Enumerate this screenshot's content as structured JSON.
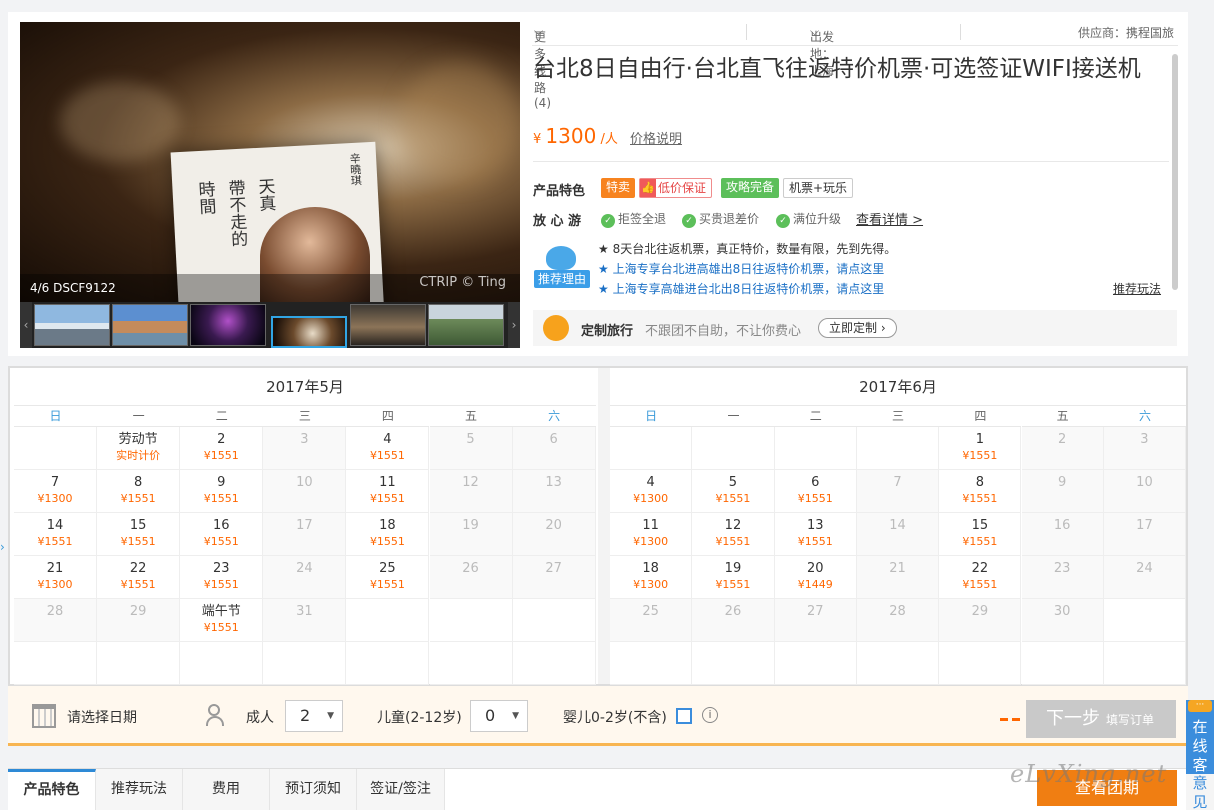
{
  "gallery": {
    "counter": "4/6",
    "filename": "DSCF9122",
    "copyright": "CTRIP © Ting",
    "book_text": [
      "時間",
      "帶不走的",
      "天真"
    ],
    "book_author": "辛曉琪"
  },
  "header": {
    "more_routes": "更多线路(4)",
    "departure": "出发地：上海",
    "supplier": "供应商：携程国旅"
  },
  "product": {
    "title": "台北8日自由行·台北直飞往返特价机票·可选签证WIFI接送机",
    "currency": "¥",
    "price": "1300",
    "price_unit": "/人",
    "price_note": "价格说明"
  },
  "features": {
    "label": "产品特色",
    "tags": [
      "特卖",
      "低价保证",
      "攻略完备",
      "机票+玩乐"
    ]
  },
  "assurance": {
    "label": "放 心 游",
    "items": [
      "拒签全退",
      "买贵退差价",
      "满位升级"
    ],
    "details_link": "查看详情 >"
  },
  "recommend": {
    "badge": "推荐理由",
    "lines": [
      "★ 8天台北往返机票，真正特价，数量有限，先到先得。",
      "★ 上海专享台北进高雄出8日往返特价机票，请点这里",
      "★ 上海专享高雄进台北出8日往返特价机票，请点这里"
    ],
    "more_link": "推荐玩法"
  },
  "custom_travel": {
    "title": "定制旅行",
    "desc": "不跟团不自助，不让你费心",
    "button": "立即定制 ›"
  },
  "calendar": {
    "weekdays": [
      "日",
      "一",
      "二",
      "三",
      "四",
      "五",
      "六"
    ],
    "months": [
      {
        "title": "2017年5月",
        "first_weekday": 1,
        "days": [
          {
            "d": "劳动节",
            "p": "实时计价"
          },
          {
            "d": "2",
            "p": "¥1551"
          },
          {
            "d": "3",
            "p": ""
          },
          {
            "d": "4",
            "p": "¥1551"
          },
          {
            "d": "5",
            "p": ""
          },
          {
            "d": "6",
            "p": ""
          },
          {
            "d": "7",
            "p": "¥1300"
          },
          {
            "d": "8",
            "p": "¥1551"
          },
          {
            "d": "9",
            "p": "¥1551"
          },
          {
            "d": "10",
            "p": ""
          },
          {
            "d": "11",
            "p": "¥1551"
          },
          {
            "d": "12",
            "p": ""
          },
          {
            "d": "13",
            "p": ""
          },
          {
            "d": "14",
            "p": "¥1551"
          },
          {
            "d": "15",
            "p": "¥1551"
          },
          {
            "d": "16",
            "p": "¥1551"
          },
          {
            "d": "17",
            "p": ""
          },
          {
            "d": "18",
            "p": "¥1551"
          },
          {
            "d": "19",
            "p": ""
          },
          {
            "d": "20",
            "p": ""
          },
          {
            "d": "21",
            "p": "¥1300"
          },
          {
            "d": "22",
            "p": "¥1551"
          },
          {
            "d": "23",
            "p": "¥1551"
          },
          {
            "d": "24",
            "p": ""
          },
          {
            "d": "25",
            "p": "¥1551"
          },
          {
            "d": "26",
            "p": ""
          },
          {
            "d": "27",
            "p": ""
          },
          {
            "d": "28",
            "p": ""
          },
          {
            "d": "29",
            "p": ""
          },
          {
            "d": "端午节",
            "p": "¥1551"
          },
          {
            "d": "31",
            "p": ""
          }
        ]
      },
      {
        "title": "2017年6月",
        "first_weekday": 4,
        "days": [
          {
            "d": "1",
            "p": "¥1551"
          },
          {
            "d": "2",
            "p": ""
          },
          {
            "d": "3",
            "p": ""
          },
          {
            "d": "4",
            "p": "¥1300"
          },
          {
            "d": "5",
            "p": "¥1551"
          },
          {
            "d": "6",
            "p": "¥1551"
          },
          {
            "d": "7",
            "p": ""
          },
          {
            "d": "8",
            "p": "¥1551"
          },
          {
            "d": "9",
            "p": ""
          },
          {
            "d": "10",
            "p": ""
          },
          {
            "d": "11",
            "p": "¥1300"
          },
          {
            "d": "12",
            "p": "¥1551"
          },
          {
            "d": "13",
            "p": "¥1551"
          },
          {
            "d": "14",
            "p": ""
          },
          {
            "d": "15",
            "p": "¥1551"
          },
          {
            "d": "16",
            "p": ""
          },
          {
            "d": "17",
            "p": ""
          },
          {
            "d": "18",
            "p": "¥1300"
          },
          {
            "d": "19",
            "p": "¥1551"
          },
          {
            "d": "20",
            "p": "¥1449"
          },
          {
            "d": "21",
            "p": ""
          },
          {
            "d": "22",
            "p": "¥1551"
          },
          {
            "d": "23",
            "p": ""
          },
          {
            "d": "24",
            "p": ""
          },
          {
            "d": "25",
            "p": ""
          },
          {
            "d": "26",
            "p": ""
          },
          {
            "d": "27",
            "p": ""
          },
          {
            "d": "28",
            "p": ""
          },
          {
            "d": "29",
            "p": ""
          },
          {
            "d": "30",
            "p": ""
          }
        ]
      }
    ]
  },
  "booking": {
    "date_placeholder": "请选择日期",
    "adult_label": "成人",
    "adult_value": "2",
    "child_label": "儿童(2-12岁)",
    "child_value": "0",
    "infant_label": "婴儿0-2岁(不含)",
    "next_label": "下一步",
    "next_sub": "填写订单"
  },
  "tabs": [
    "产品特色",
    "推荐玩法",
    "费用",
    "预订须知",
    "签证/签注"
  ],
  "tab_action": "查看团期",
  "side_widget": {
    "text": "在线客服",
    "feedback": "意见反馈"
  },
  "watermark": "eLvXing.net",
  "colors": {
    "accent": "#f60",
    "blue": "#3b8ddc",
    "green": "#5cbf5a"
  }
}
